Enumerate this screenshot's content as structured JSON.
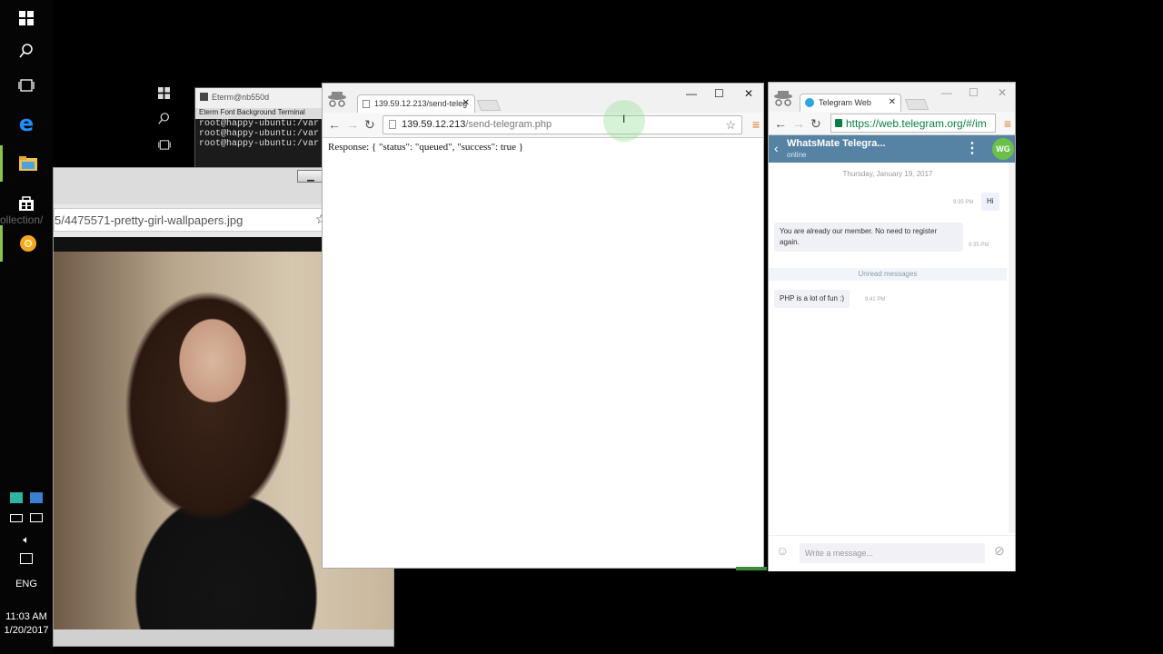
{
  "taskbar": {
    "language": "ENG",
    "time": "11:03 AM",
    "date": "1/20/2017"
  },
  "terminal": {
    "title": "Eterm@nb550d",
    "menu": "Eterm  Font  Background  Terminal",
    "lines": [
      "root@happy-ubuntu:/var",
      "root@happy-ubuntu:/var",
      "root@happy-ubuntu:/var"
    ]
  },
  "image_window": {
    "side_label": "ollection/",
    "url": "5/4475571-pretty-girl-wallpapers.jpg"
  },
  "chrome": {
    "tab_title": "139.59.12.213/send-teleg",
    "url_host": "139.59.12.213",
    "url_path": "/send-telegram.php",
    "response": "Response: { \"status\": \"queued\", \"success\": true }"
  },
  "telegram": {
    "tab_title": "Telegram Web",
    "url": "https://web.telegram.org/#/im",
    "chat_name": "WhatsMate Telegra...",
    "status": "online",
    "avatar": "WG",
    "date": "Thursday, January 19, 2017",
    "messages": [
      {
        "text": "Hi",
        "time": "9:35 PM"
      },
      {
        "text": "You are already our member. No need to register again.",
        "time": "9:35 PM"
      },
      {
        "text": "PHP is a lot of fun :)",
        "time": "9:41 PM"
      }
    ],
    "unread": "Unread messages",
    "input_placeholder": "Write a message..."
  }
}
